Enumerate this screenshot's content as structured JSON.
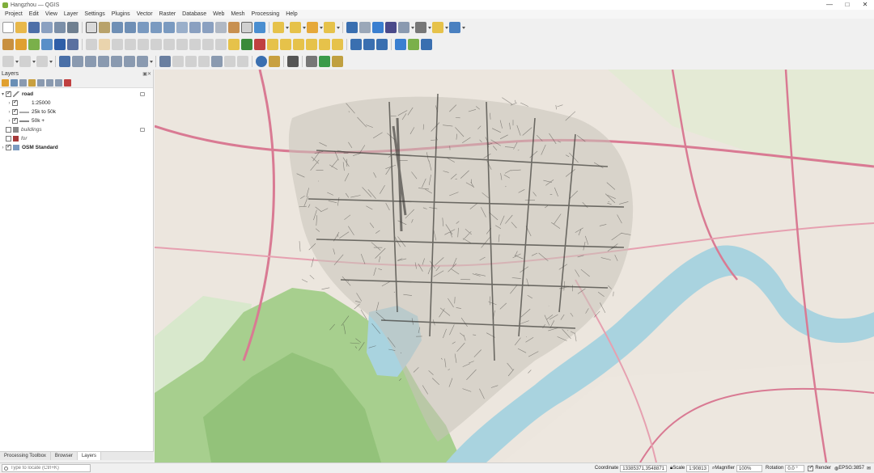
{
  "window": {
    "title": "Hangzhou — QGIS",
    "controls": [
      "—",
      "□",
      "✕"
    ]
  },
  "menu": [
    "Project",
    "Edit",
    "View",
    "Layer",
    "Settings",
    "Plugins",
    "Vector",
    "Raster",
    "Database",
    "Web",
    "Mesh",
    "Processing",
    "Help"
  ],
  "colors": {
    "accent": "#3a6fb0",
    "water": "#a9d3df",
    "forest": "#a7cf8e",
    "urban": "#ece6de",
    "highway": "#d97a93",
    "road_line": "#3c3a36"
  },
  "layers_panel": {
    "title": "Layers",
    "items": [
      {
        "label": "road",
        "checked": true,
        "expanded": true,
        "bold": true,
        "kind": "group"
      },
      {
        "label": "1:25000",
        "checked": true,
        "kind": "rule"
      },
      {
        "label": "25k to 50k",
        "checked": true,
        "kind": "rule"
      },
      {
        "label": "50k +",
        "checked": true,
        "kind": "rule"
      },
      {
        "label": "buildings",
        "checked": false,
        "italic": true,
        "kind": "polygon",
        "swatch": "#8c8c8c"
      },
      {
        "label": "for",
        "checked": false,
        "italic": true,
        "kind": "polygon",
        "swatch": "#a63a3a"
      },
      {
        "label": "OSM Standard",
        "checked": true,
        "bold": true,
        "kind": "raster"
      }
    ]
  },
  "bottom_tabs": [
    "Processing Toolbox",
    "Browser",
    "Layers"
  ],
  "status": {
    "locator_placeholder": "Type to locate (Ctrl+K)",
    "coordinate_label": "Coordinate",
    "coordinate_value": "13385371,3548871",
    "scale_label": "Scale",
    "scale_value": "1:90813",
    "magnifier_label": "Magnifier",
    "magnifier_value": "100%",
    "rotation_label": "Rotation",
    "rotation_value": "0.0 °",
    "render_label": "Render",
    "crs_label": "EPSG:3857"
  }
}
